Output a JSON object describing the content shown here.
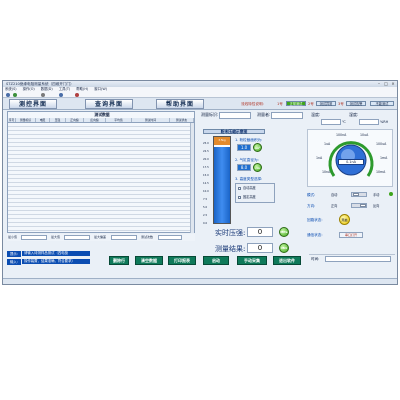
{
  "window": {
    "title": "STZ210绝缘电阻测量系统（四维开门门）",
    "min": "–",
    "max": "□",
    "close": "×"
  },
  "menu": [
    "系统(S)",
    "操作(O)",
    "数据(D)",
    "工具(T)",
    "帮助(H)",
    "窗口(W)"
  ],
  "toolbar": {
    "items": [
      "",
      "",
      "",
      "",
      ""
    ]
  },
  "nav": {
    "measure": "测控界面",
    "query": "查询界面",
    "help": "帮助界面"
  },
  "header": {
    "color_legend_label": "流线特性说明:",
    "badges": [
      "1号",
      "正常测试",
      "2号",
      "测试异常",
      "3号",
      "测试告警",
      "不能测试"
    ],
    "sample_label": "测量标识:",
    "operator_label": "测量者:",
    "temperature_label": "温度:",
    "temperature_unit": "℃",
    "humidity_label": "湿度:",
    "humidity_unit": "%RH"
  },
  "grid": {
    "title": "测试数据",
    "columns": [
      "序号",
      "测量标识",
      "电阻",
      "压强",
      "正向偏",
      "反向偏",
      "平均值",
      "测试时间",
      "测试状态"
    ]
  },
  "bar": {
    "title": "粉末压缩示意图",
    "value_label": "3.5kg",
    "ticks": [
      "25.0",
      "22.5",
      "20.0",
      "17.5",
      "15.0",
      "12.5",
      "10.0",
      "7.5",
      "5.0",
      "2.5",
      "0.0"
    ],
    "fill_fraction": 0.88
  },
  "params": {
    "p1_label": "1. 粉粒截面积为:",
    "p1_value": "1.0",
    "p1_unit": "cm²",
    "p2_label": "2. 气缸直径为:",
    "p2_value": "8.0",
    "p2_unit": "cm",
    "p3_label": "3. 高度类型选择:",
    "opt1": "自动高度",
    "opt2": "固定高度"
  },
  "readout": {
    "pressure_label": "实时压强:",
    "pressure_value": "0",
    "pressure_btn": "MPa",
    "result_label": "测量结果:",
    "result_value": "0",
    "result_btn": "MΩ"
  },
  "knob": {
    "ranges": [
      "100nA",
      "10uA",
      "1uA",
      "100uA",
      "1nA",
      "1mA",
      "10nA",
      "10mA"
    ],
    "center_value": "0.1nA"
  },
  "switches": {
    "row1_label": "模式:",
    "row1_left": "自动",
    "row1_right": "手动",
    "row2_label": "方向:",
    "row2_left": "正向",
    "row2_right": "反向",
    "row3_label": "回路状态:",
    "row3_btn": "开启",
    "row4_label": "通信状态:",
    "row4_value": "串口打开"
  },
  "footer_stats": [
    "最小值",
    "最大值",
    "最大偏差",
    "测试次数"
  ],
  "info": {
    "tag": "提示:",
    "tag2": "输入:",
    "line1": "请输入待测样品测试（四电极",
    "line2": "操作装置，结果准确，符合要求）"
  },
  "actions": [
    "删除行",
    "清空数据",
    "打印报表",
    "启动",
    "手动采集",
    "退出软件"
  ],
  "statusbar": {
    "time_label": "时间:"
  }
}
